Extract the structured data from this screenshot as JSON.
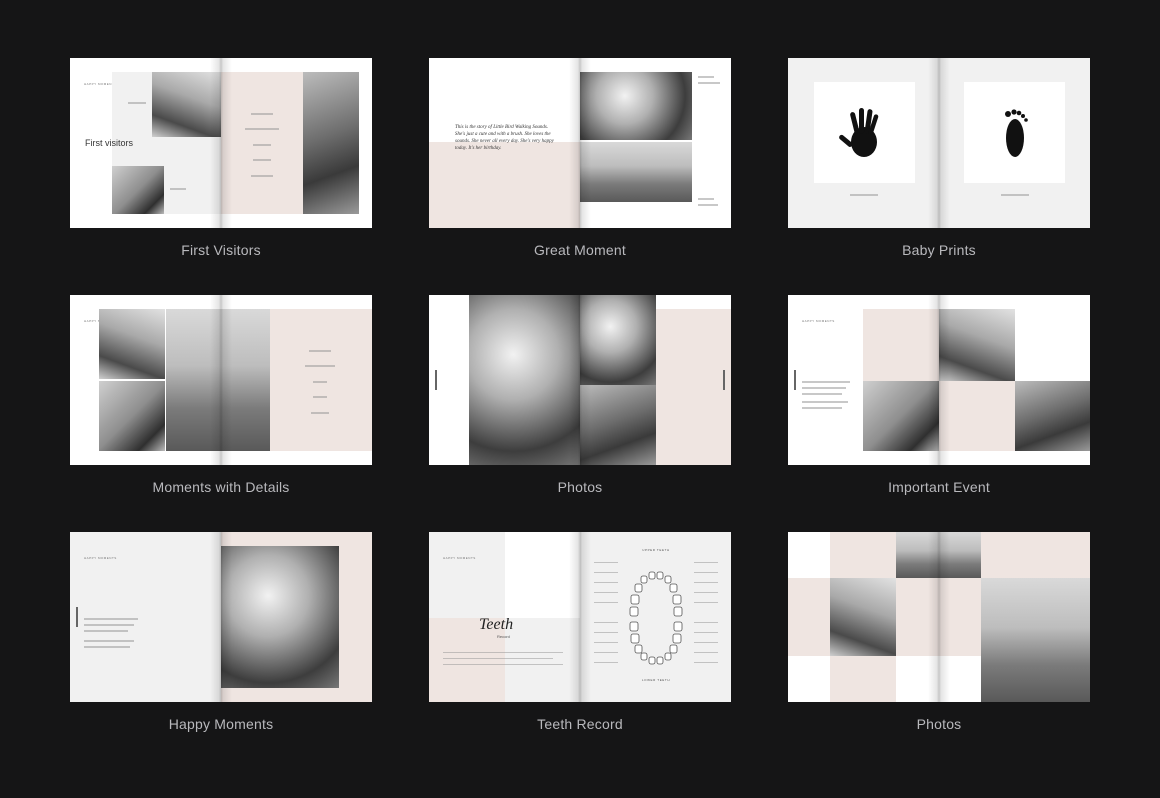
{
  "templates": [
    {
      "name": "First Visitors",
      "layout": "first-visitors",
      "heading": "First visitors"
    },
    {
      "name": "Great Moment",
      "layout": "great-moment",
      "script": "This is the story of Little Bird Walking Sounds. She's just a cute and with a brush. She loves the sounds. She never all every day. She's very happy today. It's her birthday."
    },
    {
      "name": "Baby Prints",
      "layout": "baby-prints",
      "date_left": "20 December 2018",
      "date_right": "20 December 2018"
    },
    {
      "name": "Moments with Details",
      "layout": "moments-details",
      "details": [
        "10 months",
        "25 October 2018",
        "7 kilo",
        "61 cm",
        "Nursing"
      ]
    },
    {
      "name": "Photos",
      "layout": "photos-1"
    },
    {
      "name": "Important Event",
      "layout": "important-event"
    },
    {
      "name": "Happy Moments",
      "layout": "happy-moments"
    },
    {
      "name": "Teeth Record",
      "layout": "teeth-record",
      "script_title": "Teeth",
      "subtitle": "Record",
      "upper_label": "UPPER TEETH",
      "lower_label": "LOWER TEETH"
    },
    {
      "name": "Photos",
      "layout": "photos-2"
    }
  ]
}
